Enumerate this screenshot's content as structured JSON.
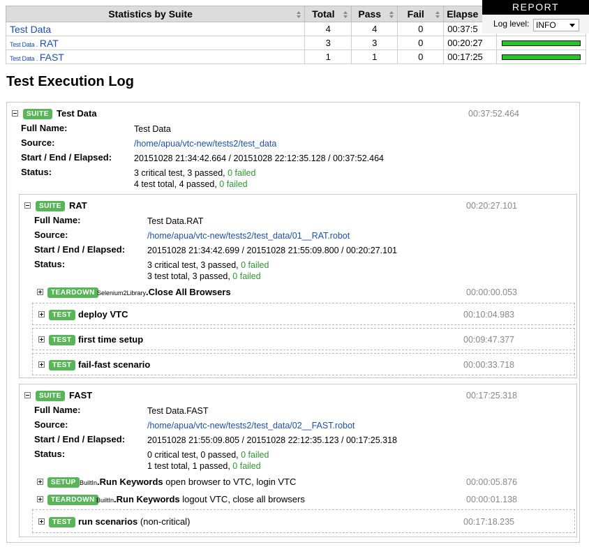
{
  "report": {
    "label": "REPORT",
    "log_level_label": "Log level:",
    "log_level_value": "INFO"
  },
  "stats": {
    "headers": [
      "Statistics by Suite",
      "Total",
      "Pass",
      "Fail",
      "Elapse"
    ],
    "rows": [
      {
        "parent": "",
        "sep": "",
        "name": "Test Data",
        "total": "4",
        "pass": "4",
        "fail": "0",
        "elapsed": "00:37:5",
        "pass_ratio": 1.0
      },
      {
        "parent": "Test Data",
        "sep": " . ",
        "name": "RAT",
        "total": "3",
        "pass": "3",
        "fail": "0",
        "elapsed": "00:20:27",
        "pass_ratio": 1.0
      },
      {
        "parent": "Test Data",
        "sep": " . ",
        "name": "FAST",
        "total": "1",
        "pass": "1",
        "fail": "0",
        "elapsed": "00:17:25",
        "pass_ratio": 1.0
      }
    ]
  },
  "log_title": "Test Execution Log",
  "labels": {
    "full_name": "Full Name:",
    "source": "Source:",
    "start_end": "Start / End / Elapsed:",
    "status": "Status:",
    "suite_badge": "SUITE",
    "test_badge": "TEST",
    "teardown_badge": "TEARDOWN",
    "setup_badge": "SETUP"
  },
  "root": {
    "name": "Test Data",
    "elapsed": "00:37:52.464",
    "full_name": "Test Data",
    "source": "/home/apua/vtc-new/tests2/test_data",
    "times": "20151028 21:34:42.664 / 20151028 22:12:35.128 / 00:37:52.464",
    "status1": "3 critical test, 3 passed, ",
    "status1_fail": "0 failed",
    "status2": "4 test total, 4 passed, ",
    "status2_fail": "0 failed"
  },
  "rat": {
    "name": "RAT",
    "elapsed": "00:20:27.101",
    "full_name": "Test Data.RAT",
    "source": "/home/apua/vtc-new/tests2/test_data/01__RAT.robot",
    "times": "20151028 21:34:42.699 / 20151028 21:55:09.800 / 00:20:27.101",
    "status1": "3 critical test, 3 passed, ",
    "status1_fail": "0 failed",
    "status2": "3 test total, 3 passed, ",
    "status2_fail": "0 failed",
    "teardown": {
      "lib": "Selenium2Library",
      "name": "Close All Browsers",
      "elapsed": "00:00:00.053"
    },
    "tests": [
      {
        "name": "deploy VTC",
        "elapsed": "00:10:04.983"
      },
      {
        "name": "first time setup",
        "elapsed": "00:09:47.377"
      },
      {
        "name": "fail-fast scenario",
        "elapsed": "00:00:33.718"
      }
    ]
  },
  "fast": {
    "name": "FAST",
    "elapsed": "00:17:25.318",
    "full_name": "Test Data.FAST",
    "source": "/home/apua/vtc-new/tests2/test_data/02__FAST.robot",
    "times": "20151028 21:55:09.805 / 20151028 22:12:35.123 / 00:17:25.318",
    "status1": "0 critical test, 0 passed, ",
    "status1_fail": "0 failed",
    "status2": "1 test total, 1 passed, ",
    "status2_fail": "0 failed",
    "setup": {
      "lib": "BuiltIn",
      "name": "Run Keywords",
      "args": "open browser to VTC, login VTC",
      "elapsed": "00:00:05.876"
    },
    "teardown": {
      "lib": "BuiltIn",
      "name": "Run Keywords",
      "args": "logout VTC, close all browsers",
      "elapsed": "00:00:01.138"
    },
    "tests": [
      {
        "name": "run scenarios",
        "note": "(non-critical)",
        "elapsed": "00:17:18.235"
      }
    ]
  }
}
